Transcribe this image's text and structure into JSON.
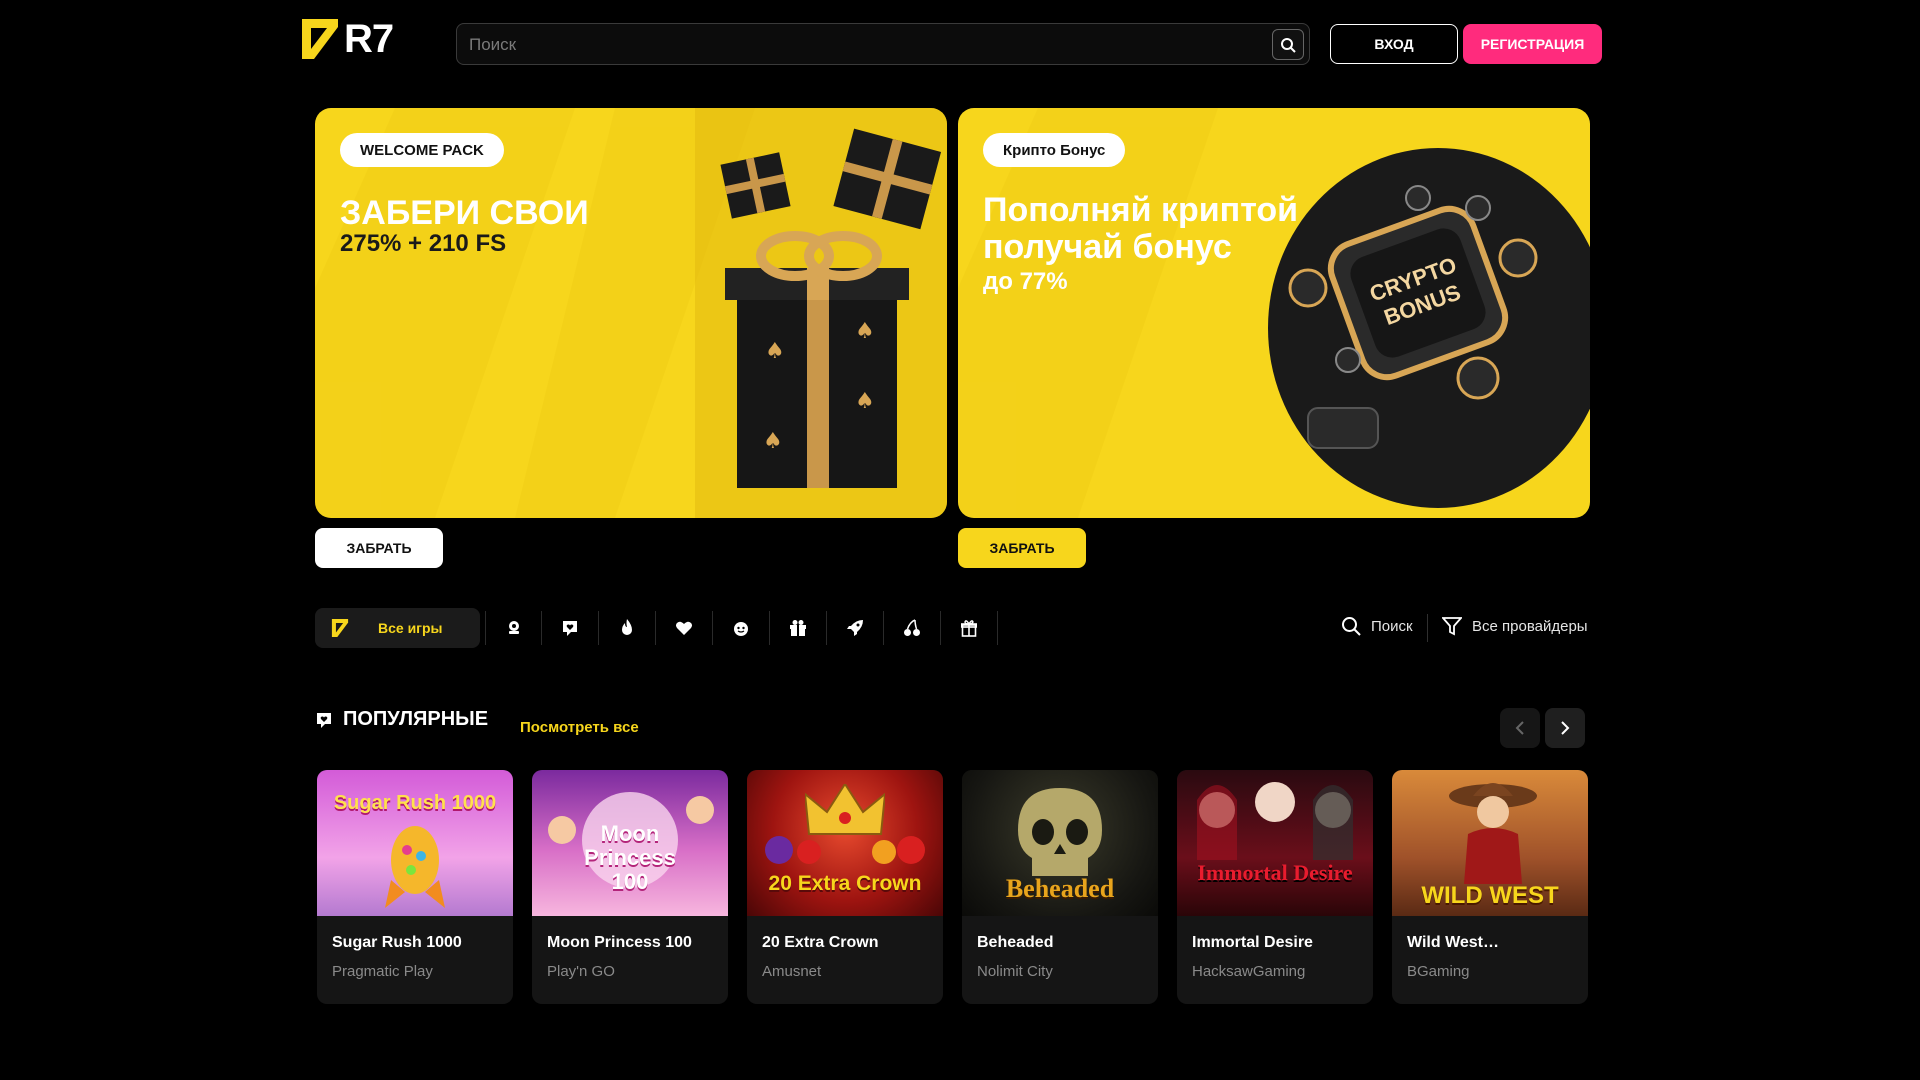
{
  "header": {
    "logo_text": "R7",
    "search_placeholder": "Поиск",
    "login_label": "ВХОД",
    "register_label": "РЕГИСТРАЦИЯ"
  },
  "banners": [
    {
      "pill": "WELCOME PACK",
      "title": "ЗАБЕРИ СВОИ",
      "subtitle": "275% + 210 FS",
      "button": "ЗАБРАТЬ"
    },
    {
      "pill": "Крипто Бонус",
      "title": "Пополняй криптой получай бонус",
      "subtitle": "до 77%",
      "button": "ЗАБРАТЬ",
      "art_text_1": "CRYPTO",
      "art_text_2": "BONUS"
    }
  ],
  "categories": {
    "all_label": "Все игры",
    "icons": [
      "live-dealer-icon",
      "favorites-icon",
      "fire-icon",
      "heart-icon",
      "face-icon",
      "gift-box-icon",
      "rocket-icon",
      "cherries-icon",
      "present-icon"
    ],
    "search_label": "Поиск",
    "providers_label": "Все провайдеры"
  },
  "popular": {
    "title": "ПОПУЛЯРНЫЕ",
    "see_all": "Посмотреть все"
  },
  "games": [
    {
      "name": "Sugar Rush 1000",
      "provider": "Pragmatic Play",
      "thumb_text": "Sugar Rush 1000"
    },
    {
      "name": "Moon Princess 100",
      "provider": "Play'n GO",
      "thumb_text": "Moon Princess 100"
    },
    {
      "name": "20 Extra Crown",
      "provider": "Amusnet",
      "thumb_text": "20 Extra Crown"
    },
    {
      "name": "Beheaded",
      "provider": "Nolimit City",
      "thumb_text": "Beheaded"
    },
    {
      "name": "Immortal Desire",
      "provider": "HacksawGaming",
      "thumb_text": "Immortal Desire"
    },
    {
      "name": "Wild West…",
      "provider": "BGaming",
      "thumb_text": "WILD WEST"
    }
  ],
  "colors": {
    "accent_yellow": "#f7d61c",
    "register_pink": "#ff2b7d",
    "background": "#000000",
    "card": "#151515"
  }
}
